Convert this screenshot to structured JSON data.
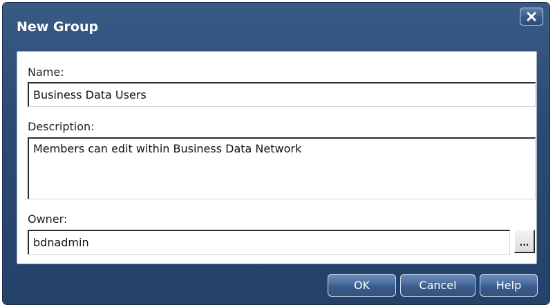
{
  "dialog": {
    "title": "New Group",
    "close_label": "Close"
  },
  "form": {
    "name": {
      "label": "Name:",
      "value": "Business Data Users"
    },
    "description": {
      "label": "Description:",
      "value": "Members can edit within Business Data Network"
    },
    "owner": {
      "label": "Owner:",
      "value": "bdnadmin",
      "browse_label": "..."
    }
  },
  "buttons": {
    "ok": "OK",
    "cancel": "Cancel",
    "help": "Help"
  },
  "colors": {
    "frame": "#2b4a76",
    "button": "#4a6c9c",
    "panel": "#ffffff"
  },
  "icons": {
    "close": "close-icon"
  }
}
